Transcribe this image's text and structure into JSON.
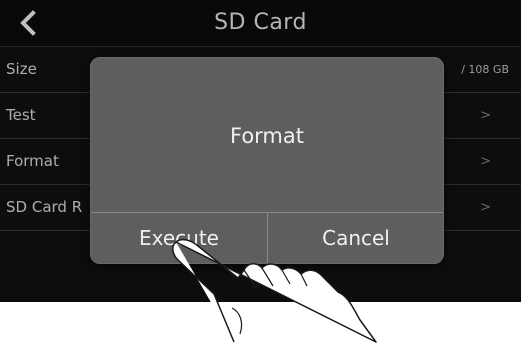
{
  "header": {
    "title": "SD Card",
    "back_icon": "chevron-left-icon"
  },
  "rows": [
    {
      "label": "Size",
      "value": "/ 108 GB",
      "chevron": ""
    },
    {
      "label": "Test",
      "value": "",
      "chevron": ">"
    },
    {
      "label": "Format",
      "value": "",
      "chevron": ">"
    },
    {
      "label": "SD Card R",
      "value": "",
      "chevron": ">"
    }
  ],
  "dialog": {
    "title": "Format",
    "execute_label": "Execute",
    "cancel_label": "Cancel"
  },
  "colors": {
    "screen_bg": "#121212",
    "dialog_bg": "#5e5e5e",
    "text": "#f0f0f0"
  },
  "overlay_icon": "pointing-hand-icon"
}
